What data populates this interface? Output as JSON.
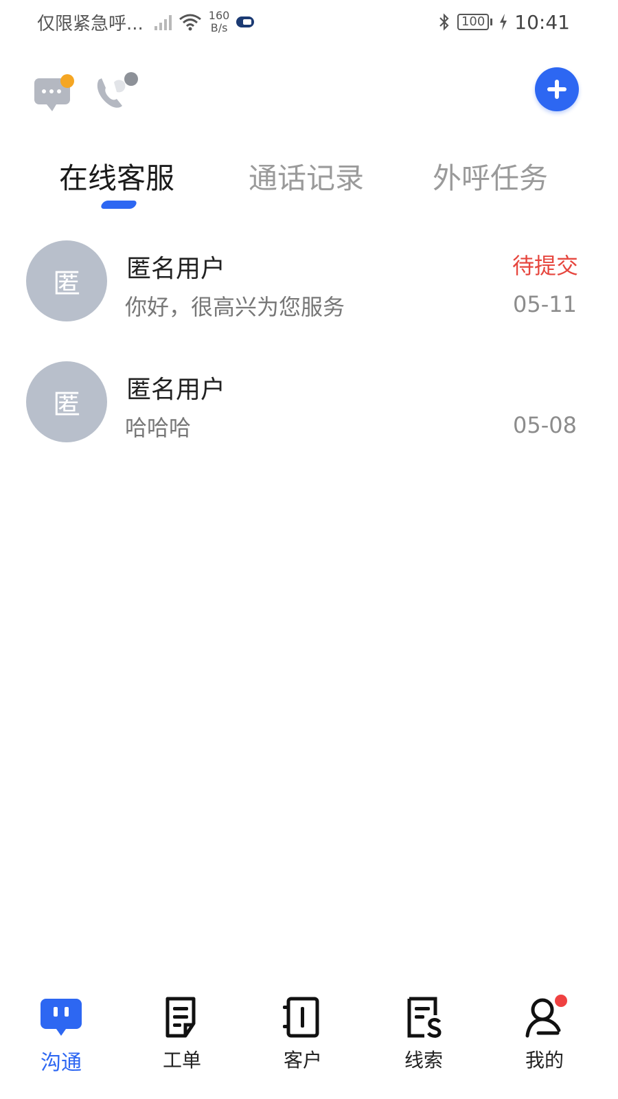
{
  "status_bar": {
    "carrier": "仅限紧急呼...",
    "speed_value": "160",
    "speed_unit": "B/s",
    "battery": "100",
    "time": "10:41"
  },
  "tabs": [
    {
      "label": "在线客服",
      "active": true
    },
    {
      "label": "通话记录",
      "active": false
    },
    {
      "label": "外呼任务",
      "active": false
    }
  ],
  "conversations": [
    {
      "avatar": "匿",
      "name": "匿名用户",
      "preview": "你好，很高兴为您服务",
      "status": "待提交",
      "date": "05-11"
    },
    {
      "avatar": "匿",
      "name": "匿名用户",
      "preview": "哈哈哈",
      "status": "",
      "date": "05-08"
    }
  ],
  "bottom_nav": [
    {
      "label": "沟通",
      "icon": "chat-icon",
      "active": true
    },
    {
      "label": "工单",
      "icon": "ticket-icon",
      "active": false
    },
    {
      "label": "客户",
      "icon": "customer-icon",
      "active": false
    },
    {
      "label": "线索",
      "icon": "lead-icon",
      "active": false
    },
    {
      "label": "我的",
      "icon": "profile-icon",
      "active": false
    }
  ],
  "colors": {
    "accent": "#2d67f2",
    "status_pending": "#e6463e",
    "notify_orange": "#f5a623",
    "badge_red": "#ef4141"
  }
}
